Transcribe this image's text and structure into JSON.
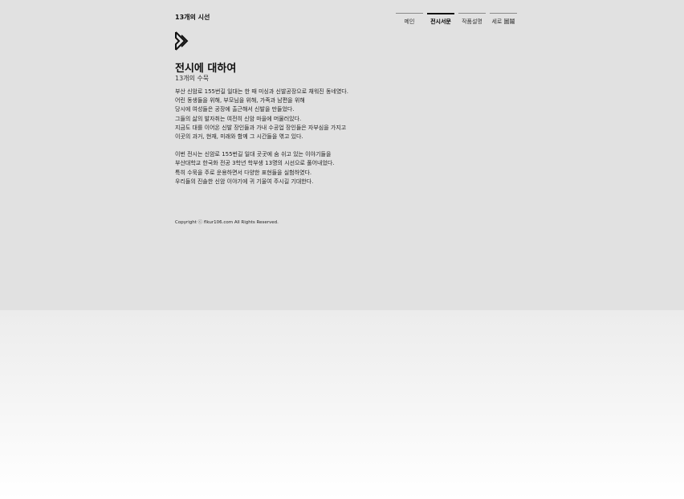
{
  "header": {
    "site_title": "13개의 시선",
    "nav": [
      {
        "label": "메인"
      },
      {
        "label": "전시서문"
      },
      {
        "label": "작품설명"
      },
      {
        "label": "세로 圖鬮"
      }
    ]
  },
  "logo": {
    "icon": "arrow-diamond-logo"
  },
  "main": {
    "title": "전시에 대하여",
    "subtitle": "13개의 수묵",
    "paragraph1": [
      "부산 신암로 155번길 일대는 한 때 미싱과 신발공장으로 채워진 동네였다.",
      "어린 동생들을 위해, 부모님을 위해, 가족과 남편을 위해",
      "당시에 여성들은 공장에 출근해서 신발을 만들었다.",
      "그들의 삶의 발자취는 여전히 신암 마을에 머물러있다.",
      "지금도 대를 이어온 신발 장인들과 가내 수공업 장인들은 자부심을 가지고",
      "이곳의 과거, 현재, 미래와 함께 그 시간들을 엮고 있다."
    ],
    "paragraph2": [
      "이번 전시는 신암로 155번길 일대 곳곳에 숨 쉬고 있는 이야기들을",
      "부산대학교 한국화 전공 3학년 학부생 13명의 시선으로 풀어내었다.",
      "특히 수묵을 주로 운용하면서 다양한 표현들을 실험하였다.",
      "우리들의 진솔한 신암 이야기에 귀 기울여 주시길 기대한다."
    ]
  },
  "footer": {
    "copyright": "Copyright ⓒ flkur106.com All Rights Reserved."
  }
}
